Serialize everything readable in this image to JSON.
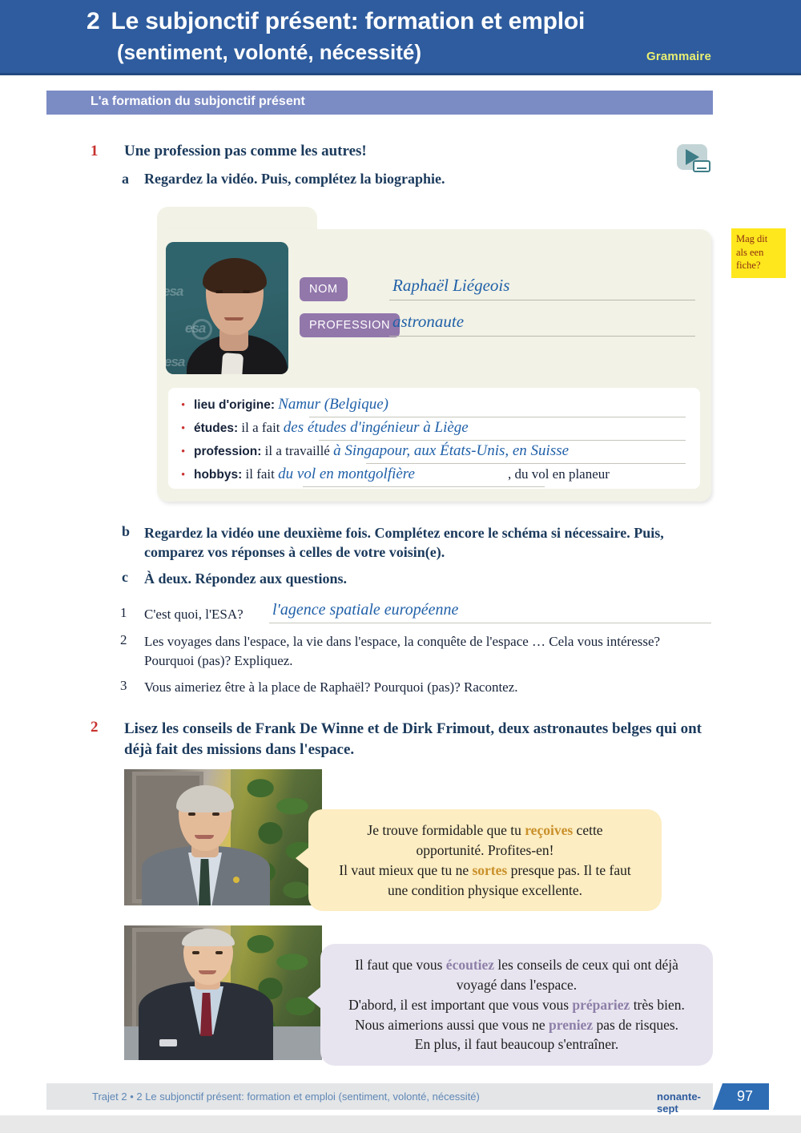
{
  "header": {
    "unit_number": "2",
    "title": "Le subjonctif présent: formation et emploi",
    "subtitle": "(sentiment, volonté, nécessité)",
    "tag": "Grammaire",
    "bg_color": "#2e5c9e",
    "tag_color": "#e9ef72"
  },
  "section": {
    "label": "L'a formation du subjonctif présent",
    "bg_color": "#7b8bc4"
  },
  "exercise1": {
    "number": "1",
    "title": "Une profession pas comme les autres!",
    "a": {
      "letter": "a",
      "text": "Regardez la vidéo. Puis, complétez la biographie."
    },
    "b": {
      "letter": "b",
      "text": "Regardez la vidéo une deuxième fois. Complétez encore le schéma si nécessaire. Puis, comparez vos réponses à celles de votre voisin(e)."
    },
    "c": {
      "letter": "c",
      "text": "À deux. Répondez aux questions."
    },
    "questions": [
      {
        "num": "1",
        "text": "C'est quoi, l'ESA?",
        "answer": "l'agence spatiale européenne"
      },
      {
        "num": "2",
        "text": "Les voyages dans l'espace, la vie dans l'espace, la conquête de l'espace … Cela vous intéresse? Pourquoi (pas)? Expliquez.",
        "answer": ""
      },
      {
        "num": "3",
        "text": "Vous aimeriez être à la place de Raphaël? Pourquoi (pas)? Racontez.",
        "answer": ""
      }
    ]
  },
  "sticky_note": {
    "text": "Mag dit als een fiche?",
    "bg_color": "#ffe71d",
    "text_color": "#8a2e12"
  },
  "biocard": {
    "photo_alt": "Raphaël Liégeois portrait on teal ESA backdrop",
    "fields": [
      {
        "tag": "NOM",
        "answer": "Raphaël Liégeois"
      },
      {
        "tag": "PROFESSION",
        "answer": "astronaute"
      }
    ],
    "tag_color": "#9277ab",
    "answer_color": "#2060a8",
    "details": [
      {
        "label": "lieu d'origine:",
        "pre": "",
        "answer": "Namur (Belgique)",
        "post": ""
      },
      {
        "label": "études:",
        "pre": "il a fait",
        "answer": "des études d'ingénieur à Liège",
        "post": ""
      },
      {
        "label": "profession:",
        "pre": "il a travaillé",
        "answer": "à Singapour, aux États-Unis, en Suisse",
        "post": ""
      },
      {
        "label": "hobbys:",
        "pre": "il fait",
        "answer": "du vol en montgolfière",
        "post": ", du vol en planeur"
      }
    ]
  },
  "exercise2": {
    "number": "2",
    "text": "Lisez les conseils de Frank De Winne et de Dirk Frimout, deux astronautes belges qui ont déjà fait des missions dans l'espace."
  },
  "bubbles": [
    {
      "speaker": "Frank De Winne",
      "bg_color": "#fcedc2",
      "highlight_color": "#c9902a",
      "lines": [
        [
          {
            "t": "Je trouve formidable que tu ",
            "hl": false
          },
          {
            "t": "reçoives",
            "hl": true
          },
          {
            "t": " cette",
            "hl": false
          }
        ],
        [
          {
            "t": "opportunité. Profites-en!",
            "hl": false
          }
        ],
        [
          {
            "t": "Il vaut mieux que tu ne ",
            "hl": false
          },
          {
            "t": "sortes",
            "hl": true
          },
          {
            "t": " presque pas. Il te faut",
            "hl": false
          }
        ],
        [
          {
            "t": "une condition physique excellente.",
            "hl": false
          }
        ]
      ]
    },
    {
      "speaker": "Dirk Frimout",
      "bg_color": "#e7e4ef",
      "highlight_color": "#8d7fa8",
      "lines": [
        [
          {
            "t": "Il faut que vous ",
            "hl": false
          },
          {
            "t": "écoutiez",
            "hl": true
          },
          {
            "t": " les conseils de ceux qui ont déjà",
            "hl": false
          }
        ],
        [
          {
            "t": "voyagé dans l'espace.",
            "hl": false
          }
        ],
        [
          {
            "t": "D'abord, il est important que vous vous ",
            "hl": false
          },
          {
            "t": "prépariez",
            "hl": true
          },
          {
            "t": " très bien.",
            "hl": false
          }
        ],
        [
          {
            "t": "Nous aimerions aussi que vous ne ",
            "hl": false
          },
          {
            "t": "preniez",
            "hl": true
          },
          {
            "t": " pas de risques.",
            "hl": false
          }
        ],
        [
          {
            "t": "En plus, il faut beaucoup s'entraîner.",
            "hl": false
          }
        ]
      ]
    }
  ],
  "footer": {
    "text": "Trajet 2 • 2 Le subjonctif présent: formation et emploi (sentiment, volonté, nécessité)",
    "word": "nonante-sept",
    "page": "97",
    "bg_color": "#e3e5e7",
    "page_bg_color": "#2e6db4"
  }
}
